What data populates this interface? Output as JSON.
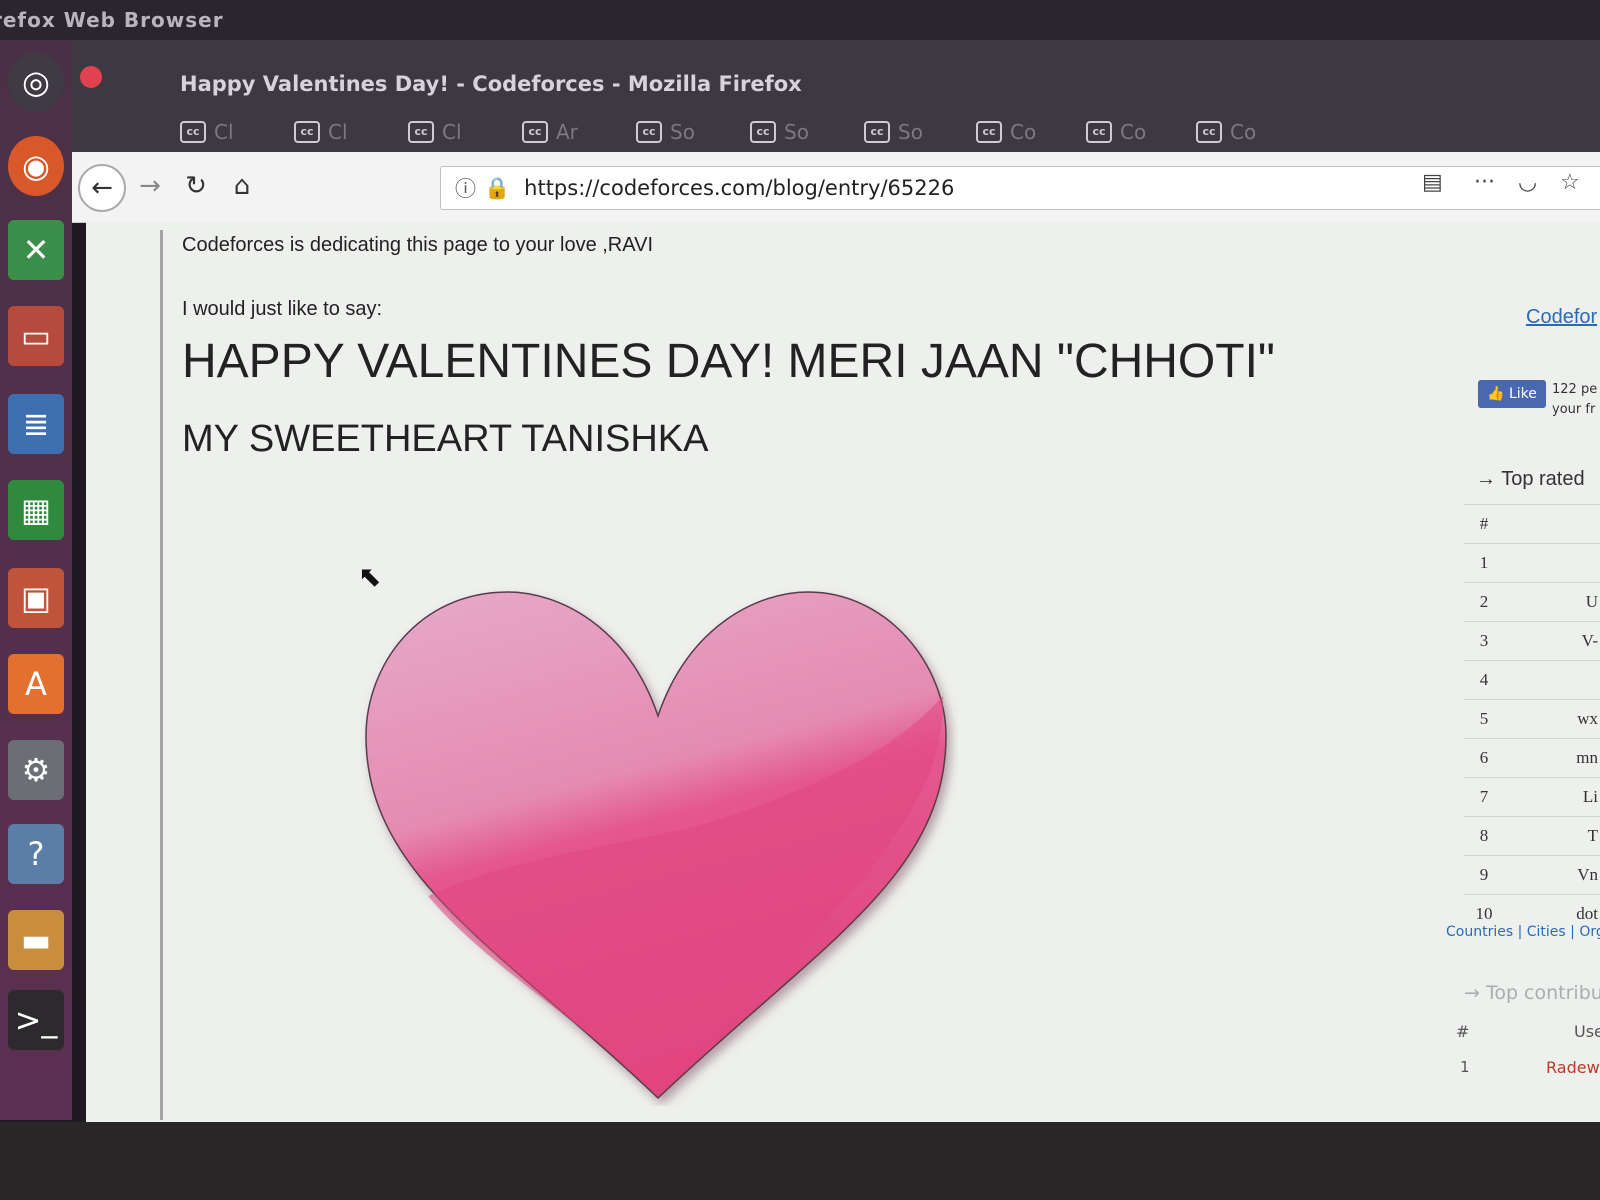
{
  "os": {
    "app_title": "refox Web Browser"
  },
  "window": {
    "title": "Happy Valentines Day! - Codeforces - Mozilla Firefox"
  },
  "tabs": [
    {
      "fav": "cc",
      "label": "Cl"
    },
    {
      "fav": "cc",
      "label": "Cl"
    },
    {
      "fav": "cc",
      "label": "Cl"
    },
    {
      "fav": "cc",
      "label": "Ar"
    },
    {
      "fav": "cc",
      "label": "So"
    },
    {
      "fav": "cc",
      "label": "So"
    },
    {
      "fav": "cc",
      "label": "So"
    },
    {
      "fav": "cc",
      "label": "Co"
    },
    {
      "fav": "cc",
      "label": "Co"
    },
    {
      "fav": "cc",
      "label": "Co"
    }
  ],
  "navbar": {
    "back_icon": "←",
    "forward_icon": "→",
    "reload_icon": "↻",
    "home_icon": "⌂",
    "url": "https://codeforces.com/blog/entry/65226",
    "info_icon": "ⓘ",
    "lock_icon": "🔒",
    "reader_icon": "▤",
    "menu_icon": "···",
    "pocket_icon": "◡",
    "star_icon": "☆"
  },
  "blog": {
    "dedication": "Codeforces is dedicating this page to your love ,RAVI",
    "intro": "I would just like to say:",
    "headline": "HAPPY VALENTINES DAY! MERI JAAN \"CHHOTI\"",
    "subhead": "MY SWEETHEART TANISHKA"
  },
  "sidebar": {
    "brand": "Codefor",
    "like_label": "Like",
    "like_count": "122 pe",
    "like_sub": "your fr",
    "top_rated_title": "→ Top rated",
    "top_rated_header": "#",
    "top_rated": [
      {
        "rank": "1",
        "handle": ""
      },
      {
        "rank": "2",
        "handle": "U"
      },
      {
        "rank": "3",
        "handle": "V-"
      },
      {
        "rank": "4",
        "handle": ""
      },
      {
        "rank": "5",
        "handle": "wx"
      },
      {
        "rank": "6",
        "handle": "mn"
      },
      {
        "rank": "7",
        "handle": "Li"
      },
      {
        "rank": "8",
        "handle": "T"
      },
      {
        "rank": "9",
        "handle": "Vn"
      },
      {
        "rank": "10",
        "handle": "dot"
      }
    ],
    "links": "Countries | Cities | Orga",
    "top_contrib_title": "→ Top contribut",
    "contrib_head_num": "#",
    "contrib_head_user": "Use",
    "contrib_row_num": "1",
    "contrib_row_user": "Radewo"
  },
  "colors": {
    "heart_light": "#e6a6c8",
    "heart_dark": "#e0457f",
    "link": "#2b6bb5",
    "like_button": "#4a68b0"
  }
}
